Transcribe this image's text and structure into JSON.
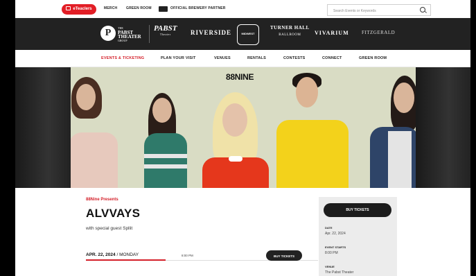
{
  "utility": {
    "pill_label": "eTeaclers",
    "links": [
      "MERCH",
      "GREEN ROOM",
      "OFFICIAL BREWERY PARTNER"
    ],
    "search_placeholder": "Search Events or Keywords"
  },
  "logos": {
    "group_small_top": "THE",
    "group_line1": "PABST",
    "group_line2": "THEATER",
    "group_small_bottom": "GROUP",
    "pabst_main": "PABST",
    "pabst_sub": "Theater",
    "riverside": "RIVERSIDE",
    "badge": "MIDWEST",
    "turner_main": "TURNER HALL",
    "turner_sub": "BALLROOM",
    "vivarium": "VIVARIUM",
    "fitzgerald": "FITZGERALD"
  },
  "nav": [
    "EVENTS & TICKETING",
    "PLAN YOUR VISIT",
    "VENUES",
    "RENTALS",
    "CONTESTS",
    "CONNECT",
    "GREEN ROOM"
  ],
  "hero": {
    "brand": "88NINE"
  },
  "event": {
    "presenter": "88Nine Presents",
    "title": "ALVVAYS",
    "guest": "with special guest Spllit",
    "date": "APR. 22, 2024",
    "weekday": "/ MONDAY",
    "time": "8:00 PM",
    "buy_label": "BUY TICKETS"
  },
  "sidebar": {
    "buy_label": "BUY TICKETS",
    "date_label": "DATE",
    "date_value": "Apr. 22, 2024",
    "start_label": "EVENT STARTS",
    "start_value": "8:00 PM",
    "venue_label": "VENUE",
    "venue_value": "The Pabst Theater"
  }
}
